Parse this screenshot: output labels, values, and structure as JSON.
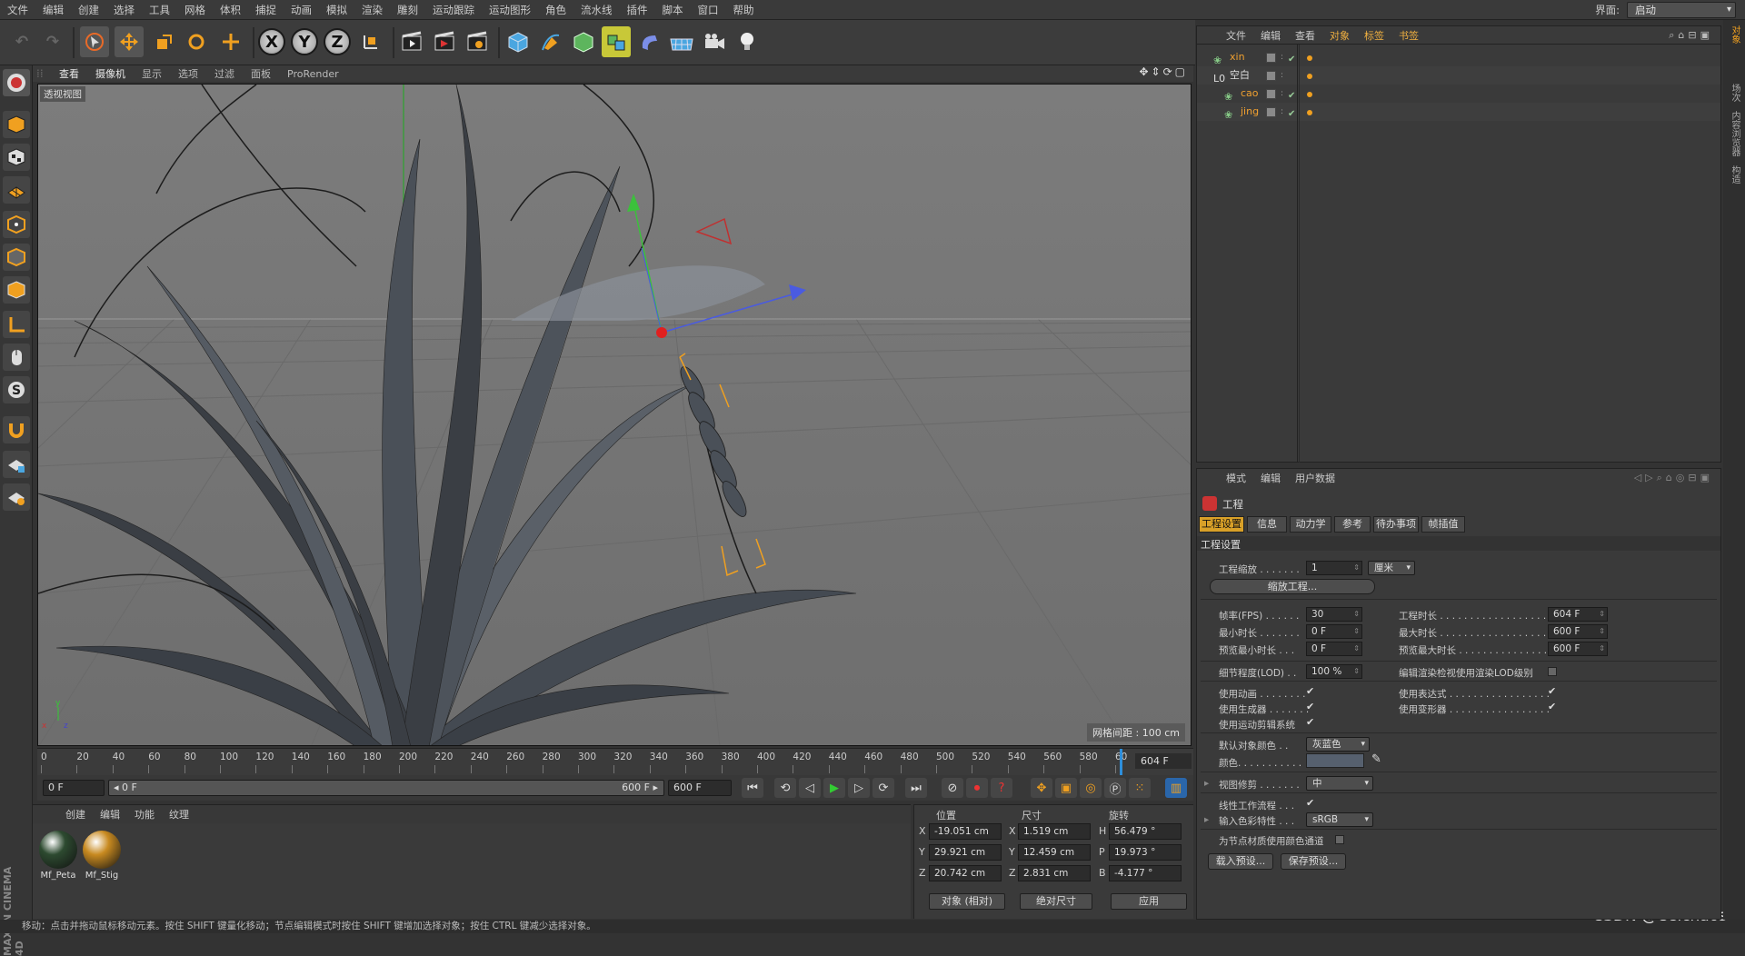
{
  "menu": [
    "文件",
    "编辑",
    "创建",
    "选择",
    "工具",
    "网格",
    "体积",
    "捕捉",
    "动画",
    "模拟",
    "渲染",
    "雕刻",
    "运动跟踪",
    "运动图形",
    "角色",
    "流水线",
    "插件",
    "脚本",
    "窗口",
    "帮助"
  ],
  "layout": {
    "label": "界面:",
    "value": "启动"
  },
  "toolbar": {
    "undo": "↶",
    "redo": "↷",
    "x": "X",
    "y": "Y",
    "z": "Z"
  },
  "viewport_menu": [
    "查看",
    "摄像机",
    "显示",
    "选项",
    "过滤",
    "面板",
    "ProRender"
  ],
  "viewport": {
    "label": "透视视图",
    "grid": "网格间距 : 100 cm",
    "icons": "✥⇕⟳▢"
  },
  "timeline": {
    "ticks": [
      "0",
      "20",
      "40",
      "60",
      "80",
      "100",
      "120",
      "140",
      "160",
      "180",
      "200",
      "220",
      "240",
      "260",
      "280",
      "300",
      "320",
      "340",
      "360",
      "380",
      "400",
      "420",
      "440",
      "460",
      "480",
      "500",
      "520",
      "540",
      "560",
      "580",
      "60"
    ],
    "current": "604 F"
  },
  "transport": {
    "start": "0 F",
    "range_start": "◂ 0 F",
    "range_end": "600 F ▸",
    "end": "600 F"
  },
  "material_menu": [
    "创建",
    "编辑",
    "功能",
    "纹理"
  ],
  "materials": [
    {
      "name": "Mf_Peta",
      "color": "#2d4a30"
    },
    {
      "name": "Mf_Stig",
      "color": "#c88a20"
    }
  ],
  "coords": {
    "headers": [
      "位置",
      "尺寸",
      "旋转"
    ],
    "rows": [
      {
        "a": "X",
        "p": "-19.051 cm",
        "s": "1.519 cm",
        "r_lbl": "H",
        "r": "56.479 °"
      },
      {
        "a": "Y",
        "p": "29.921 cm",
        "s": "12.459 cm",
        "r_lbl": "P",
        "r": "19.973 °"
      },
      {
        "a": "Z",
        "p": "20.742 cm",
        "s": "2.831 cm",
        "r_lbl": "B",
        "r": "-4.177 °"
      }
    ],
    "mode": "对象 (相对)",
    "size_mode": "绝对尺寸",
    "apply": "应用"
  },
  "status": "移动：点击并拖动鼠标移动元素。按住 SHIFT 键量化移动；节点编辑模式时按住 SHIFT 键增加选择对象；按住 CTRL 键减少选择对象。",
  "watermark": "CSDN @Ceichaos",
  "object_menu": [
    "文件",
    "编辑",
    "查看",
    "对象",
    "标签",
    "书签"
  ],
  "objects": [
    {
      "name": "xin",
      "color": "orange",
      "indent": 0
    },
    {
      "name": "空白",
      "color": "white",
      "indent": 0
    },
    {
      "name": "cao",
      "color": "orange",
      "indent": 1
    },
    {
      "name": "jing",
      "color": "orange",
      "indent": 1
    }
  ],
  "attr_menu": [
    "模式",
    "编辑",
    "用户数据"
  ],
  "attr_title": "工程",
  "attr_tabs": [
    "工程设置",
    "信息",
    "动力学",
    "参考",
    "待办事项",
    "帧插值"
  ],
  "attr_section": "工程设置",
  "attr": {
    "scale_lbl": "工程缩放 . . . . . . .",
    "scale_val": "1",
    "scale_unit": "厘米",
    "scale_btn": "缩放工程...",
    "fps_lbl": "帧率(FPS) . . . . . .",
    "fps": "30",
    "len_lbl": "工程时长 . . . . . . . . . . . . . . . . . .",
    "len": "604 F",
    "min_lbl": "最小时长 . . . . . . .",
    "min": "0 F",
    "max_lbl": "最大时长 . . . . . . . . . . . . . . . . . .",
    "max": "600 F",
    "pmin_lbl": "预览最小时长 . . .",
    "pmin": "0 F",
    "pmax_lbl": "预览最大时长 . . . . . . . . . . . . . . .",
    "pmax": "600 F",
    "lod_lbl": "细节程度(LOD) . .",
    "lod": "100 %",
    "lod2_lbl": "编辑渲染检视使用渲染LOD级别",
    "anim_lbl": "使用动画 . . . . . . . .",
    "expr_lbl": "使用表达式 . . . . . . . . . . . . . . . . .",
    "gen_lbl": "使用生成器 . . . . . . .",
    "def_lbl": "使用变形器 . . . . . . . . . . . . . . . . .",
    "mo_lbl": "使用运动剪辑系统",
    "defcol_lbl": "默认对象颜色 . .",
    "defcol": "灰蓝色",
    "col_lbl": "颜色. . . . . . . . . . .",
    "clip_lbl": "视图修剪 . . . . . . .",
    "clip": "中",
    "linear_lbl": "线性工作流程 . . .",
    "incol_lbl": "输入色彩特性 . . .",
    "incol": "sRGB",
    "node_lbl": "为节点材质使用颜色通道",
    "load_btn": "载入预设...",
    "save_btn": "保存预设..."
  },
  "right_tabs": [
    "对象",
    "场次",
    "内容浏览器",
    "构造"
  ]
}
